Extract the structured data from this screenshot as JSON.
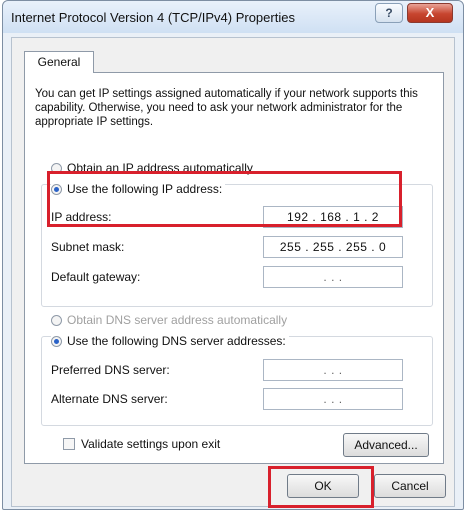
{
  "window": {
    "title": "Internet Protocol Version 4 (TCP/IPv4) Properties",
    "help_label": "?",
    "close_label": "X"
  },
  "tabs": [
    {
      "label": "General"
    }
  ],
  "intro_text": "You can get IP settings assigned automatically if your network supports this capability. Otherwise, you need to ask your network administrator for the appropriate IP settings.",
  "ip_section": {
    "auto_label": "Obtain an IP address automatically",
    "manual_label": "Use the following IP address:",
    "fields": [
      {
        "label": "IP address:",
        "value": "192 . 168 . 1 . 2"
      },
      {
        "label": "Subnet mask:",
        "value": "255 . 255 . 255 . 0"
      },
      {
        "label": "Default gateway:",
        "value": ".     .     ."
      }
    ]
  },
  "dns_section": {
    "auto_label": "Obtain DNS server address automatically",
    "manual_label": "Use the following DNS server addresses:",
    "fields": [
      {
        "label": "Preferred DNS server:",
        "value": ".     .     ."
      },
      {
        "label": "Alternate DNS server:",
        "value": ".     .     ."
      }
    ]
  },
  "validate_label": "Validate settings upon exit",
  "buttons": {
    "advanced": "Advanced...",
    "ok": "OK",
    "cancel": "Cancel"
  },
  "colors": {
    "highlight": "#d8202c",
    "radio_selected": "#2a62c8"
  }
}
